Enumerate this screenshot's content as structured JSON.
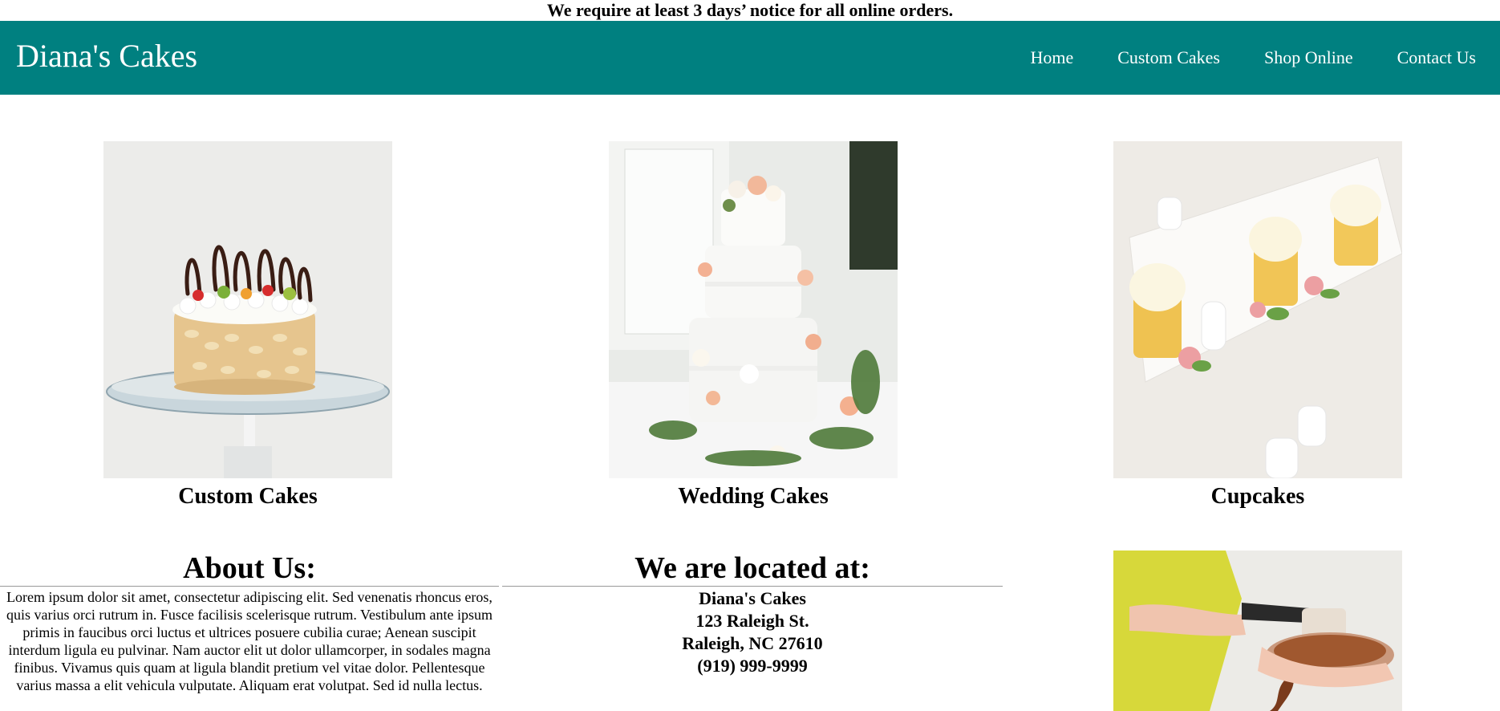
{
  "notice": "We require at least 3 days’ notice for all online orders.",
  "header": {
    "brand": "Diana's Cakes",
    "nav": [
      "Home",
      "Custom Cakes",
      "Shop Online",
      "Contact Us"
    ]
  },
  "gallery": [
    {
      "caption": "Custom Cakes",
      "image": "custom-cake-photo"
    },
    {
      "caption": "Wedding Cakes",
      "image": "wedding-cake-photo"
    },
    {
      "caption": "Cupcakes",
      "image": "cupcakes-photo"
    }
  ],
  "about": {
    "title": "About Us:",
    "text": "Lorem ipsum dolor sit amet, consectetur adipiscing elit. Sed venenatis rhoncus eros, quis varius orci rutrum in. Fusce facilisis scelerisque rutrum. Vestibulum ante ipsum primis in faucibus orci luctus et ultrices posuere cubilia curae; Aenean suscipit interdum ligula eu pulvinar. Nam auctor elit ut dolor ullamcorper, in sodales magna finibus. Vivamus quis quam at ligula blandit pretium vel vitae dolor. Pellentesque varius massa a elit vehicula vulputate. Aliquam erat volutpat. Sed id nulla lectus."
  },
  "location": {
    "title": "We are located at:",
    "lines": [
      "Diana's Cakes",
      "123 Raleigh St.",
      "Raleigh, NC 27610",
      "(919) 999-9999"
    ]
  },
  "colors": {
    "header_bg": "#008080",
    "header_text": "#ffffff"
  }
}
